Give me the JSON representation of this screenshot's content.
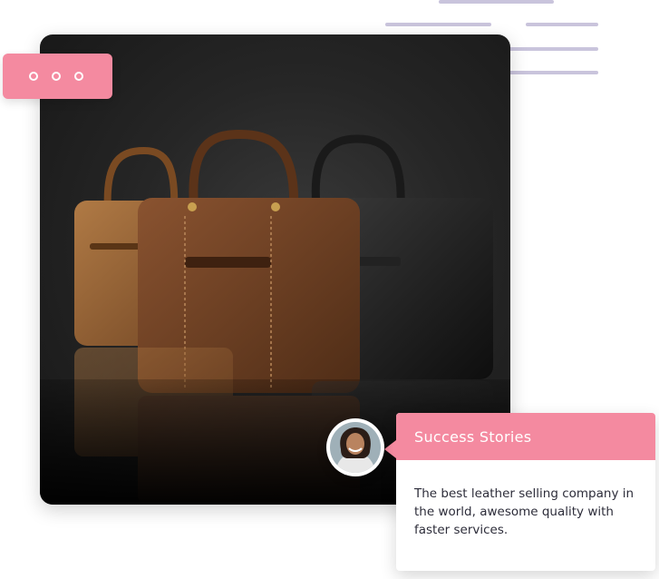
{
  "card": {
    "title": "Success Stories",
    "text": "The best leather selling company in the world, awesome quality with faster services."
  },
  "icons": [
    "more-dots-icon",
    "avatar"
  ],
  "colors": {
    "accent": "#f48aa0",
    "decor_lines": "#c9c4dc",
    "photo_background": "#1f1f1f",
    "body_text": "#2d2d3a"
  }
}
